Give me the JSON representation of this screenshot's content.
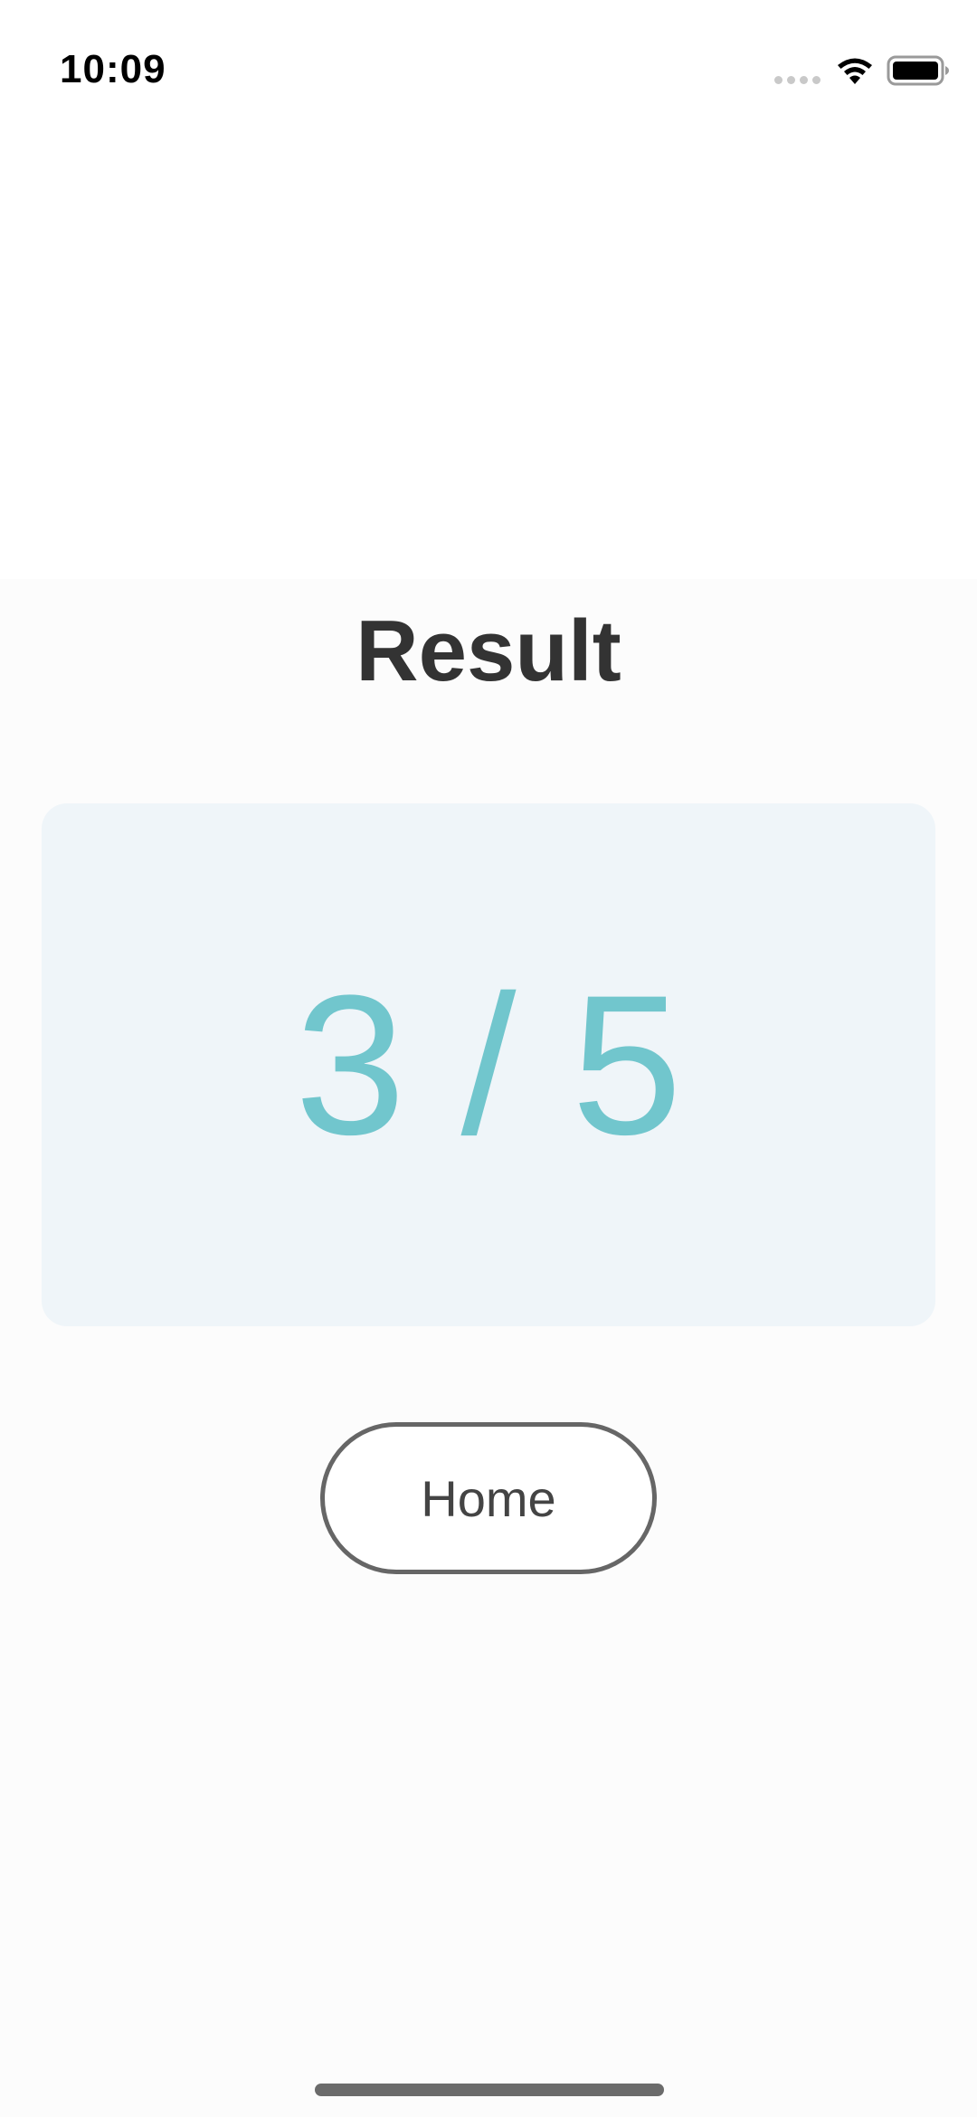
{
  "status_bar": {
    "time": "10:09",
    "signal_icon": "signal-dots-icon",
    "wifi_icon": "wifi-icon",
    "battery_icon": "battery-icon"
  },
  "page": {
    "title": "Result"
  },
  "score": {
    "display": "3 / 5",
    "correct": 3,
    "total": 5,
    "color": "#71c6cd",
    "card_background": "#eff5f9"
  },
  "actions": {
    "home_label": "Home"
  }
}
